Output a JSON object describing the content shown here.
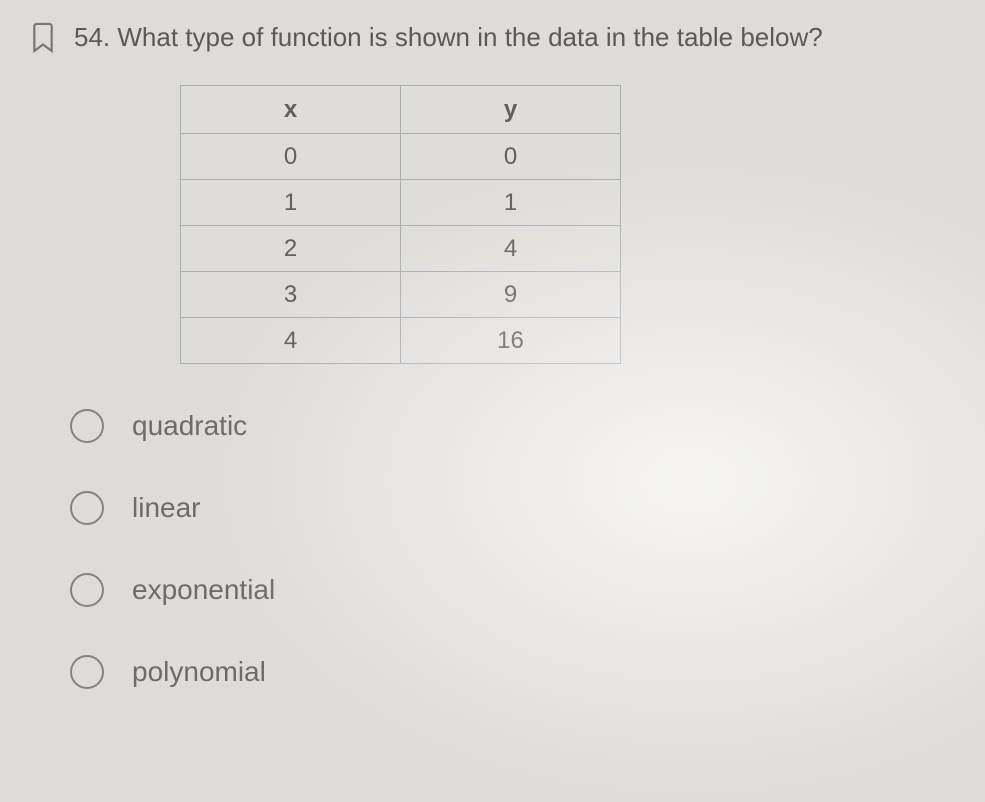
{
  "question": {
    "number": "54.",
    "text": "What type of function is shown in the data in the table below?"
  },
  "table": {
    "headers": [
      "x",
      "y"
    ],
    "rows": [
      [
        "0",
        "0"
      ],
      [
        "1",
        "1"
      ],
      [
        "2",
        "4"
      ],
      [
        "3",
        "9"
      ],
      [
        "4",
        "16"
      ]
    ]
  },
  "options": [
    "quadratic",
    "linear",
    "exponential",
    "polynomial"
  ]
}
